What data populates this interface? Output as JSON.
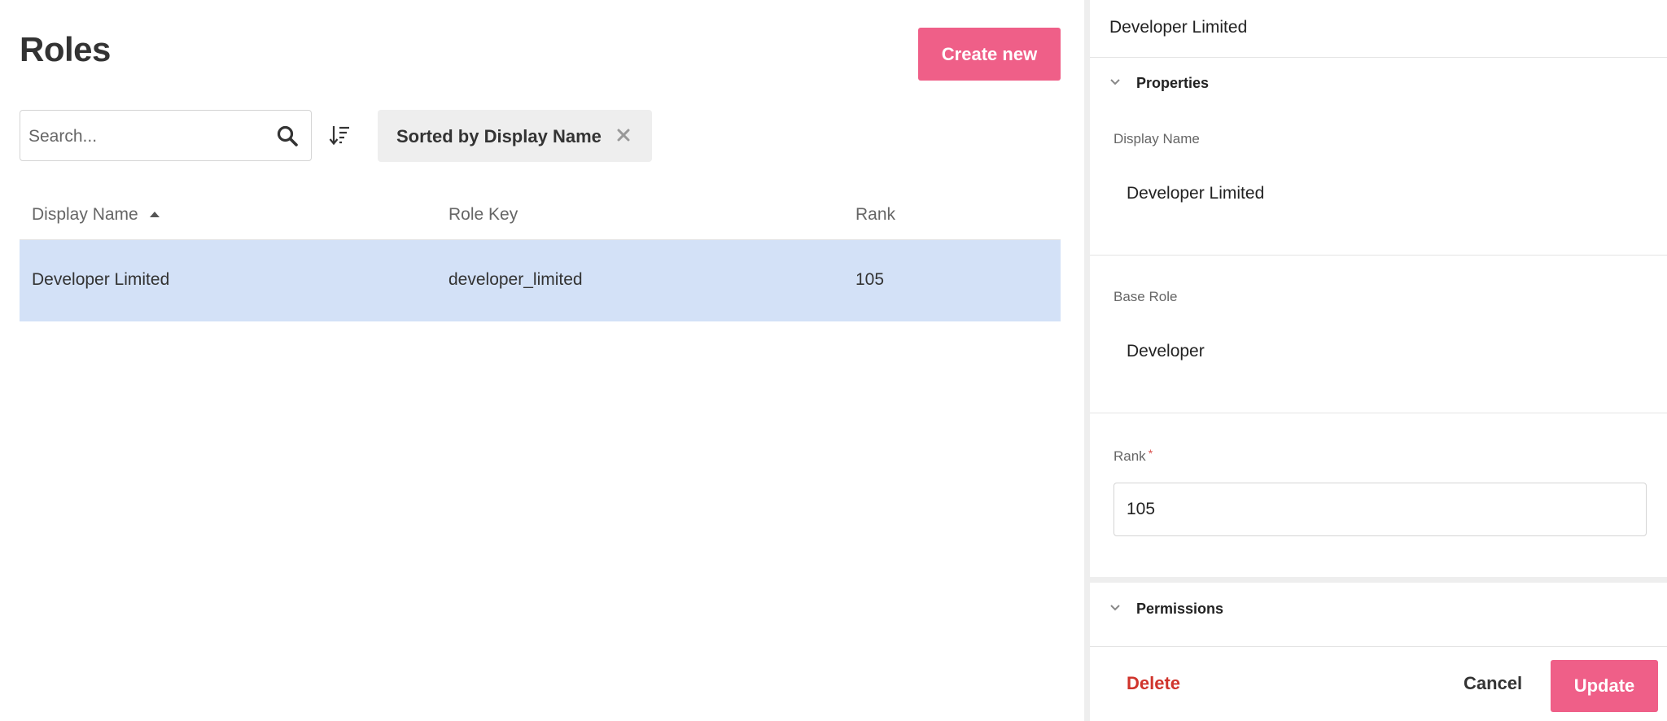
{
  "page": {
    "title": "Roles",
    "create_label": "Create new"
  },
  "search": {
    "placeholder": "Search..."
  },
  "sort_chip": {
    "label": "Sorted by Display Name"
  },
  "table": {
    "columns": [
      "Display Name",
      "Role Key",
      "Rank"
    ],
    "rows": [
      {
        "display_name": "Developer Limited",
        "role_key": "developer_limited",
        "rank": "105"
      }
    ]
  },
  "panel": {
    "title": "Developer Limited",
    "properties_label": "Properties",
    "display_name_label": "Display Name",
    "display_name_value": "Developer Limited",
    "base_role_label": "Base Role",
    "base_role_value": "Developer",
    "rank_label": "Rank",
    "rank_required_mark": "*",
    "rank_value": "105",
    "permissions_label": "Permissions",
    "delete_label": "Delete",
    "cancel_label": "Cancel",
    "update_label": "Update"
  },
  "colors": {
    "accent": "#ef5f88",
    "selected_row": "#d3e1f7",
    "danger": "#d0342c"
  }
}
